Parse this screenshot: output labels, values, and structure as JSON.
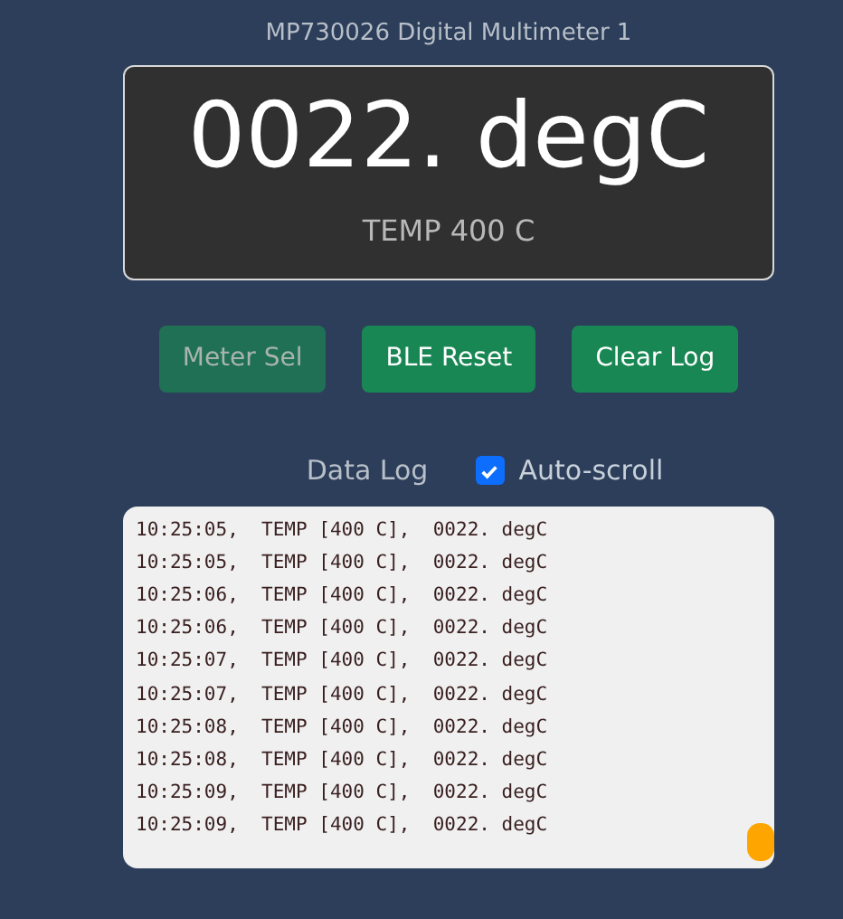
{
  "title": "MP730026 Digital Multimeter 1",
  "display": {
    "reading": "0022. degC",
    "mode": "TEMP 400 C"
  },
  "buttons": [
    {
      "label": "Meter Sel",
      "disabled": true
    },
    {
      "label": "BLE Reset",
      "disabled": false
    },
    {
      "label": "Clear Log",
      "disabled": false
    }
  ],
  "log_header": {
    "label": "Data Log",
    "auto_scroll": {
      "label": "Auto-scroll",
      "checked": true
    }
  },
  "log_lines": [
    "10:25:05,  TEMP [400 C],  0022. degC",
    "10:25:05,  TEMP [400 C],  0022. degC",
    "10:25:06,  TEMP [400 C],  0022. degC",
    "10:25:06,  TEMP [400 C],  0022. degC",
    "10:25:07,  TEMP [400 C],  0022. degC",
    "10:25:07,  TEMP [400 C],  0022. degC",
    "10:25:08,  TEMP [400 C],  0022. degC",
    "10:25:08,  TEMP [400 C],  0022. degC",
    "10:25:09,  TEMP [400 C],  0022. degC",
    "10:25:09,  TEMP [400 C],  0022. degC"
  ]
}
